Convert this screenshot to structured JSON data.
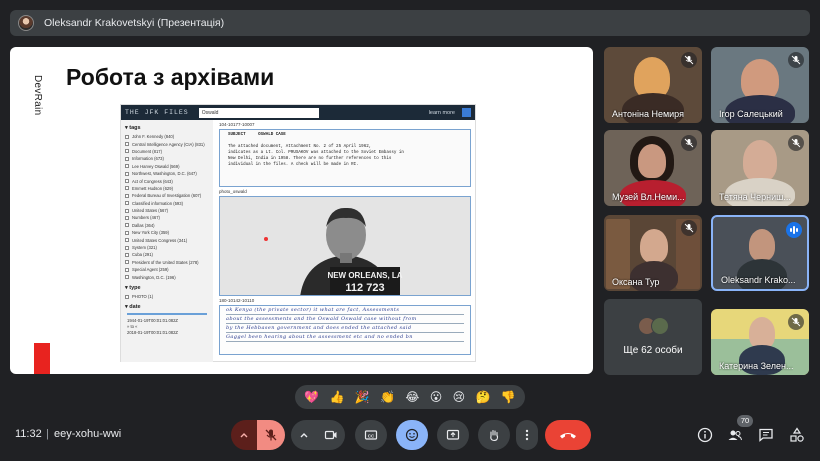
{
  "top_bar": {
    "title": "Oleksandr Krakovetskyi (Презентація)"
  },
  "slide": {
    "brand": "DevRain",
    "title": "Робота з архівами",
    "archive": {
      "logo": "THE JFK FILES",
      "search_value": "Oswald",
      "learn_more": "learn more",
      "tags_heading": "tags",
      "tags": [
        "John F. Kennedy (840)",
        "Central Intelligence Agency (CIA) (831)",
        "Document (817)",
        "Information (673)",
        "Lee Harvey Oswald (569)",
        "Northwest, Washington, D.C. (647)",
        "Act of Congress (643)",
        "Emmett Hudson (629)",
        "Federal Bureau of Investigation (607)",
        "Classified information (593)",
        "United States (567)",
        "Numbers (467)",
        "Dallas (364)",
        "New York City (359)",
        "United States Congress (341)",
        "System (321)",
        "Cuba (291)",
        "President of the United States (278)",
        "Special Agent (259)",
        "Washington, D.C. (196)"
      ],
      "type_heading": "type",
      "types": [
        "PHOTO (1)"
      ],
      "date_heading": "date",
      "date_from": "1944-01-19T00:01:01.082Z",
      "date_sep": "» to «",
      "date_to": "2018-01-19T00:01:01.082Z",
      "docs": [
        {
          "label": "104-10177-10007",
          "lines": [
            "SUBJECT     OSWALD CASE",
            "",
            "The attached document, Attachment No. 2 of 25 April 1962,",
            "indicates as a Lt. Col. PRUSAKOV was attached to the Soviet Embassy in",
            "New Delhi, India in 1958. There are no further references to this",
            "individual in the files. A check will be made in RI."
          ]
        },
        {
          "label": "photo_oswald",
          "plate_line1": "NEW ORLEANS, LA",
          "plate_line2": "112 723"
        },
        {
          "label": "180-10142-10110",
          "hand_lines": [
            "ok Kenya (the private sector) it what are fact, Assessments",
            "about the assessments and the Oswald Oswald case without from",
            "by the Hebbasen government and does ended the attached said",
            "Gaggel been hearing about the assessment etc and no ended bn"
          ]
        }
      ]
    }
  },
  "participants": [
    {
      "name": "Антоніна Немиря",
      "muted": true
    },
    {
      "name": "Ігор Салецький",
      "muted": true
    },
    {
      "name": "Музей Вл.Неми...",
      "muted": true
    },
    {
      "name": "Тетяна Черниш...",
      "muted": true
    },
    {
      "name": "Оксана Тур",
      "muted": true
    },
    {
      "name": "Oleksandr Krako...",
      "speaking": true
    },
    {
      "name": "Катерина Зелен...",
      "muted": true
    }
  ],
  "more_participants": "Ще 62 особи",
  "bottom_bar": {
    "time": "11:32",
    "separator": "|",
    "meeting_code": "eey-xohu-wwi",
    "participants_count": "70"
  },
  "reactions": [
    "💖",
    "👍",
    "🎉",
    "👏",
    "😂",
    "😮",
    "😢",
    "🤔",
    "👎"
  ],
  "colors": {
    "accent_red": "#ea4335",
    "active_blue": "#8ab4f8",
    "slide_red": "#e8231f",
    "panel": "#3c4043"
  }
}
